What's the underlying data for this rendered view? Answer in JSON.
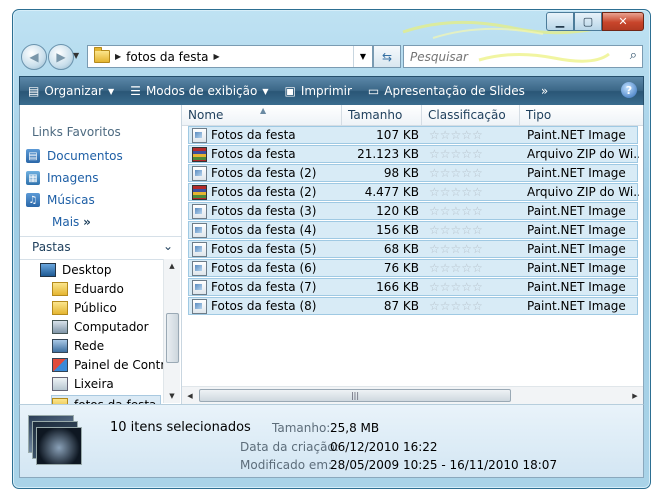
{
  "window": {
    "minimize_icon": "minimize-icon",
    "maximize_icon": "maximize-icon",
    "close_icon": "close-icon"
  },
  "address": {
    "folder": "fotos da festa",
    "search_placeholder": "Pesquisar"
  },
  "toolbar": {
    "organizar": "Organizar",
    "modos": "Modos de exibição",
    "imprimir": "Imprimir",
    "apresentacao": "Apresentação de Slides",
    "more": "»"
  },
  "nav": {
    "links_header": "Links Favoritos",
    "favorites": [
      {
        "label": "Documentos",
        "icon": "documents-icon"
      },
      {
        "label": "Imagens",
        "icon": "pictures-icon"
      },
      {
        "label": "Músicas",
        "icon": "music-icon"
      }
    ],
    "more": "Mais",
    "folders_header": "Pastas",
    "tree": [
      {
        "label": "Desktop",
        "icon": "desktop-icon"
      },
      {
        "label": "Eduardo",
        "icon": "user-folder-icon"
      },
      {
        "label": "Público",
        "icon": "folder-icon"
      },
      {
        "label": "Computador",
        "icon": "computer-icon"
      },
      {
        "label": "Rede",
        "icon": "network-icon"
      },
      {
        "label": "Painel de Contro",
        "icon": "control-panel-icon"
      },
      {
        "label": "Lixeira",
        "icon": "recycle-bin-icon"
      },
      {
        "label": "fotos da festa",
        "icon": "folder-icon"
      }
    ]
  },
  "columns": {
    "name": "Nome",
    "size": "Tamanho",
    "rating": "Classificação",
    "type": "Tipo"
  },
  "files": [
    {
      "name": "Fotos da festa",
      "size": "107 KB",
      "type": "Paint.NET Image",
      "kind": "img"
    },
    {
      "name": "Fotos da festa",
      "size": "21.123 KB",
      "type": "Arquivo ZIP do Wi...",
      "kind": "zip"
    },
    {
      "name": "Fotos da festa (2)",
      "size": "98 KB",
      "type": "Paint.NET Image",
      "kind": "img"
    },
    {
      "name": "Fotos da festa (2)",
      "size": "4.477 KB",
      "type": "Arquivo ZIP do Wi...",
      "kind": "zip"
    },
    {
      "name": "Fotos da festa (3)",
      "size": "120 KB",
      "type": "Paint.NET Image",
      "kind": "img"
    },
    {
      "name": "Fotos da festa (4)",
      "size": "156 KB",
      "type": "Paint.NET Image",
      "kind": "img"
    },
    {
      "name": "Fotos da festa (5)",
      "size": "68 KB",
      "type": "Paint.NET Image",
      "kind": "img"
    },
    {
      "name": "Fotos da festa (6)",
      "size": "76 KB",
      "type": "Paint.NET Image",
      "kind": "img"
    },
    {
      "name": "Fotos da festa (7)",
      "size": "166 KB",
      "type": "Paint.NET Image",
      "kind": "img"
    },
    {
      "name": "Fotos da festa (8)",
      "size": "87 KB",
      "type": "Paint.NET Image",
      "kind": "img"
    }
  ],
  "rating_stars": "☆☆☆☆☆",
  "details": {
    "selected": "10 itens selecionados",
    "size_label": "Tamanho:",
    "size_value": "25,8 MB",
    "created_label": "Data da criação:",
    "created_value": "06/12/2010 16:22",
    "modified_label": "Modificado em:",
    "modified_value": "28/05/2009 10:25 - 16/11/2010 18:07"
  }
}
